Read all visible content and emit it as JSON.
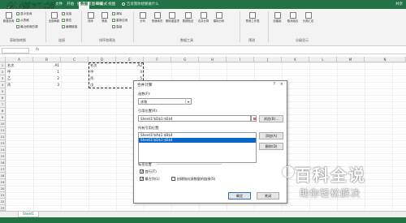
{
  "ribbon_tabs": [
    {
      "label": "文件"
    },
    {
      "label": "开始"
    },
    {
      "label": "插入"
    },
    {
      "label": "页面布局"
    },
    {
      "label": "公式"
    },
    {
      "label": "数据"
    },
    {
      "label": "审阅"
    },
    {
      "label": "视图"
    }
  ],
  "tell_me": "告诉我你想要做什么",
  "share": "共享",
  "logo_text": "秒懂视频",
  "ribbon": {
    "buttons": [
      {
        "label": "新建查询"
      },
      {
        "label": "全部刷新"
      },
      {
        "label": "排序"
      },
      {
        "label": "筛选"
      },
      {
        "label": "分列"
      },
      {
        "label": "快速填充"
      },
      {
        "label": "删除重复项"
      },
      {
        "label": "数据验证"
      },
      {
        "label": "合并计算"
      },
      {
        "label": "模拟分析"
      },
      {
        "label": "预测工作表"
      },
      {
        "label": "创建组"
      },
      {
        "label": "取消组合"
      },
      {
        "label": "分类汇总"
      }
    ],
    "small_items": [
      "显示查询",
      "从表格",
      "最近使用的源",
      "连接",
      "属性",
      "编辑链接",
      "清除",
      "重新应用",
      "高级"
    ],
    "groups": [
      "获取和转换",
      "连接",
      "排序和筛选",
      "数据工具",
      "预测",
      "分级显示"
    ]
  },
  "formula_bar": {
    "namebox": "",
    "fx": "fx"
  },
  "columns": [
    "A",
    "B",
    "C",
    "D",
    "E",
    "F",
    "G",
    "H",
    "I",
    "J",
    "K",
    "L",
    "M",
    "N"
  ],
  "rows": [
    "1",
    "2",
    "3",
    "4",
    "5",
    "6",
    "7",
    "8",
    "9",
    "10",
    "11",
    "12",
    "13",
    "14",
    "15",
    "16",
    "17",
    "18",
    "19",
    "20",
    "21",
    "22",
    "23"
  ],
  "sheet1": {
    "header": [
      "名次",
      "A1"
    ],
    "data": [
      {
        "name": "甲",
        "value": "1"
      },
      {
        "name": "乙",
        "value": "2"
      },
      {
        "name": "丙",
        "value": "3"
      }
    ]
  },
  "sheet2": {
    "header": [
      "名次",
      "A2"
    ],
    "data": [
      {
        "name": "甲",
        "value": "4"
      },
      {
        "name": "丙",
        "value": "5"
      },
      {
        "name": "戊",
        "value": "6"
      }
    ]
  },
  "dialog": {
    "title": "合并计算",
    "help": "?",
    "close": "×",
    "function_label": "函数(F):",
    "function_value": "求和",
    "reference_label": "引用位置(R):",
    "reference_value": "Sheet1!$D$1:$E$4",
    "browse_button": "浏览(B)...",
    "all_refs_label": "所有引用位置:",
    "all_refs": [
      {
        "text": "Sheet1!$A$1:$B$4",
        "selected": false
      },
      {
        "text": "Sheet1!$D$1:$E$4",
        "selected": true
      }
    ],
    "add_button": "添加(A)",
    "delete_button": "删除(D)",
    "tag_position_label": "标签位置",
    "first_row_label": "首行(T)",
    "first_row_checked": true,
    "left_column_label": "最左列(L)",
    "left_column_checked": true,
    "link_source_label": "创建指向源数据的链接(S)",
    "link_source_checked": false,
    "ok_button": "确定",
    "close_button": "关闭"
  },
  "sheet_tab": "Sheet1",
  "watermark": {
    "main": "百科全说",
    "sub": "助你轻松解决"
  },
  "colors": {
    "excel_green": "#217346",
    "selection_blue": "#0a66c8"
  }
}
